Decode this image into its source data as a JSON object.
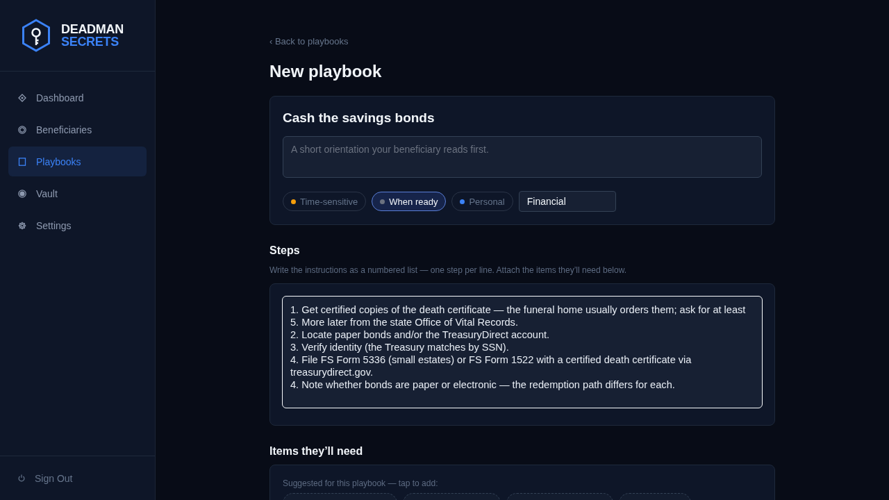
{
  "sidebar": {
    "logo": {
      "line_1": "DEADMAN",
      "line_2": "SECRETS"
    },
    "items": [
      {
        "label": "Dashboard",
        "selected": false
      },
      {
        "label": "Beneficiaries",
        "selected": false
      },
      {
        "label": "Playbooks",
        "selected": true
      },
      {
        "label": "Vault",
        "selected": false
      },
      {
        "label": "Settings",
        "selected": false
      }
    ],
    "sign_out": "Sign Out"
  },
  "back_link": "‹ Back to playbooks",
  "page_title": "New playbook",
  "playbook_card": {
    "title": "Cash the savings bonds",
    "summary": {
      "placeholder": "A short orientation your beneficiary reads first."
    },
    "urgency": [
      {
        "label": "Time-sensitive",
        "selected": false,
        "color": "#f59e0b"
      },
      {
        "label": "When ready",
        "selected": true,
        "color": "#6b7280"
      },
      {
        "label": "Personal",
        "selected": false,
        "color": "#3b82f6"
      }
    ],
    "category": {
      "value": "Financial"
    }
  },
  "steps": {
    "heading": "Steps",
    "hint": "Write the instructions as a numbered list — one step per line. Attach the items they’ll need below.",
    "field": {
      "value": "1. Get certified copies of the death certificate — the funeral home usually orders them; ask for at least 5. More later from the state Office of Vital Records.\n2. Locate paper bonds and/or the TreasuryDirect account.\n3. Verify identity (the Treasury matches by SSN).\n4. File FS Form 5336 (small estates) or FS Form 1522 with a certified death certificate via treasurydirect.gov.\n4. Note whether bonds are paper or electronic — the redemption path differs for each.",
      "focused": true
    }
  },
  "items_needed": {
    "heading": "Items they’ll need",
    "suggestion_hint": "Suggested for this playbook — tap to add:"
  }
}
